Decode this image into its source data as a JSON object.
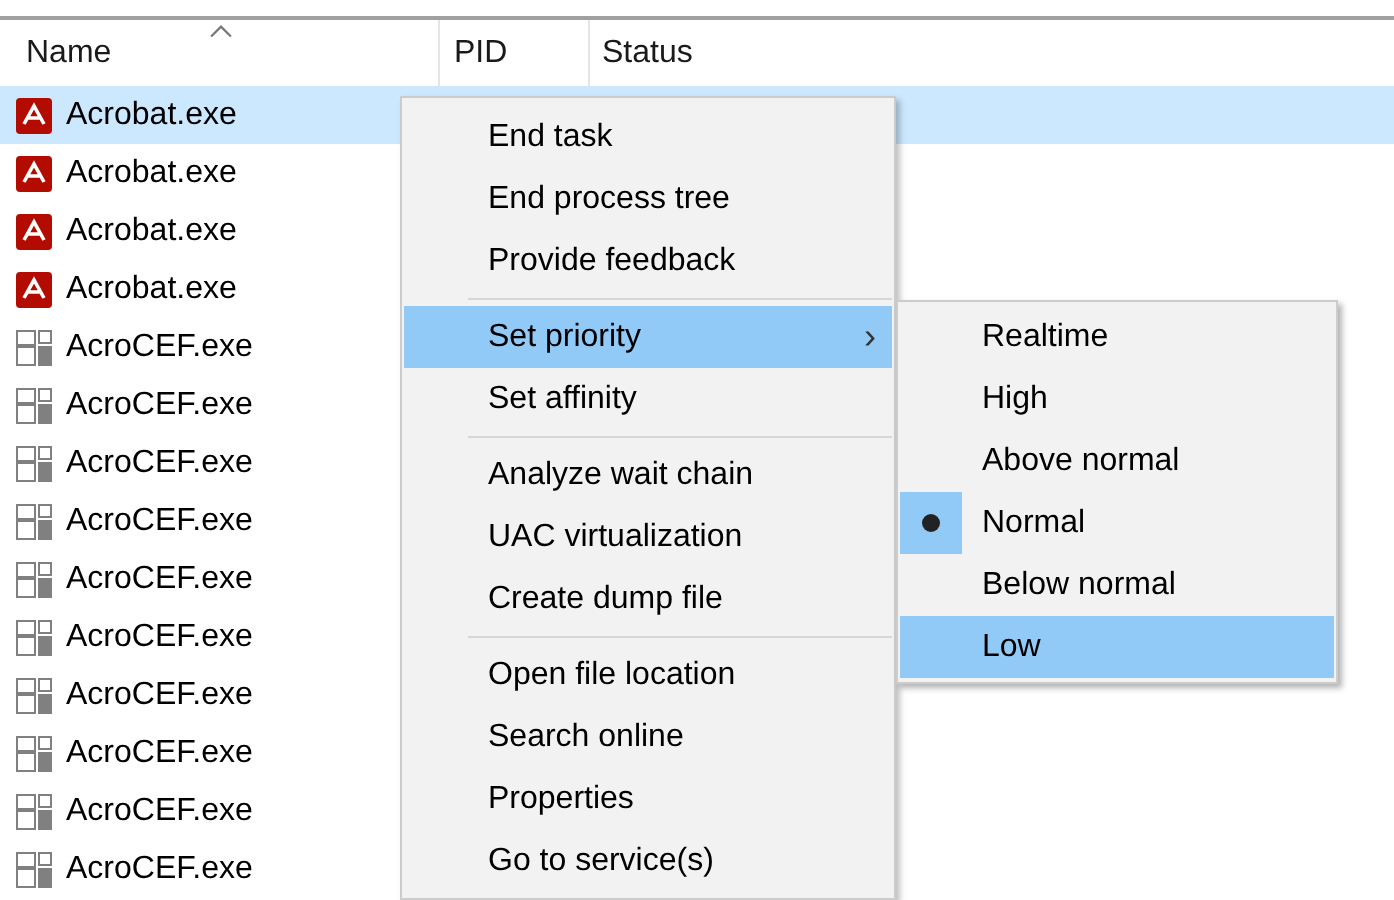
{
  "table": {
    "columns": [
      {
        "label": "Name",
        "sorted": true
      },
      {
        "label": "PID",
        "sorted": false
      },
      {
        "label": "Status",
        "sorted": false
      }
    ],
    "rows": [
      {
        "name": "Acrobat.exe",
        "kind": "acrobat",
        "selected": true
      },
      {
        "name": "Acrobat.exe",
        "kind": "acrobat",
        "selected": false
      },
      {
        "name": "Acrobat.exe",
        "kind": "acrobat",
        "selected": false
      },
      {
        "name": "Acrobat.exe",
        "kind": "acrobat",
        "selected": false
      },
      {
        "name": "AcroCEF.exe",
        "kind": "app",
        "selected": false
      },
      {
        "name": "AcroCEF.exe",
        "kind": "app",
        "selected": false
      },
      {
        "name": "AcroCEF.exe",
        "kind": "app",
        "selected": false
      },
      {
        "name": "AcroCEF.exe",
        "kind": "app",
        "selected": false
      },
      {
        "name": "AcroCEF.exe",
        "kind": "app",
        "selected": false
      },
      {
        "name": "AcroCEF.exe",
        "kind": "app",
        "selected": false
      },
      {
        "name": "AcroCEF.exe",
        "kind": "app",
        "selected": false
      },
      {
        "name": "AcroCEF.exe",
        "kind": "app",
        "selected": false
      },
      {
        "name": "AcroCEF.exe",
        "kind": "app",
        "selected": false
      },
      {
        "name": "AcroCEF.exe",
        "kind": "app",
        "selected": false
      }
    ]
  },
  "context_menu": {
    "items": [
      {
        "kind": "item",
        "label": "End task",
        "selected": false
      },
      {
        "kind": "item",
        "label": "End process tree",
        "selected": false
      },
      {
        "kind": "item",
        "label": "Provide feedback",
        "selected": false
      },
      {
        "kind": "separator"
      },
      {
        "kind": "submenu",
        "label": "Set priority",
        "arrow": "›",
        "selected": true
      },
      {
        "kind": "item",
        "label": "Set affinity",
        "selected": false
      },
      {
        "kind": "separator"
      },
      {
        "kind": "item",
        "label": "Analyze wait chain",
        "selected": false
      },
      {
        "kind": "item",
        "label": "UAC virtualization",
        "selected": false
      },
      {
        "kind": "item",
        "label": "Create dump file",
        "selected": false
      },
      {
        "kind": "separator"
      },
      {
        "kind": "item",
        "label": "Open file location",
        "selected": false
      },
      {
        "kind": "item",
        "label": "Search online",
        "selected": false
      },
      {
        "kind": "item",
        "label": "Properties",
        "selected": false
      },
      {
        "kind": "item",
        "label": "Go to service(s)",
        "selected": false
      }
    ]
  },
  "priority_submenu": {
    "items": [
      {
        "label": "Realtime",
        "checked": false,
        "selected": false
      },
      {
        "label": "High",
        "checked": false,
        "selected": false
      },
      {
        "label": "Above normal",
        "checked": false,
        "selected": false
      },
      {
        "label": "Normal",
        "checked": true,
        "selected": false
      },
      {
        "label": "Below normal",
        "checked": false,
        "selected": false
      },
      {
        "label": "Low",
        "checked": false,
        "selected": true
      }
    ]
  }
}
